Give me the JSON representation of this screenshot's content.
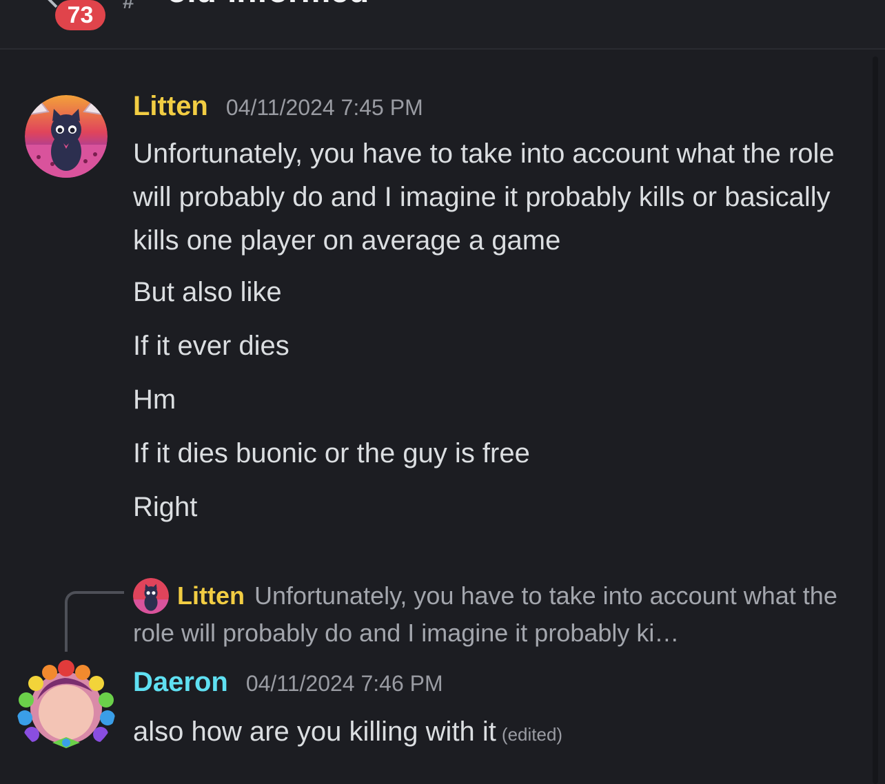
{
  "header": {
    "unread_count": "73",
    "channel_icon": "#",
    "channel_name": "old-informed"
  },
  "messages": [
    {
      "author": "Litten",
      "author_color": "#f2cd43",
      "timestamp": "04/11/2024 7:45 PM",
      "lines": [
        "Unfortunately, you have to take into account what the role will probably do and I imagine it probably kills or basically kills one player on average a game",
        "But also like",
        "If it ever dies",
        "Hm",
        "If it dies buonic or the guy is free",
        "Right"
      ]
    },
    {
      "reply_to": {
        "author": "Litten",
        "preview": "Unfortunately, you have to take into account what the role will probably do and I imagine it probably ki…"
      },
      "author": "Daeron",
      "author_color": "#5fe0f2",
      "timestamp": "04/11/2024 7:46 PM",
      "text": "also how are you killing with it",
      "edited_label": "(edited)"
    }
  ]
}
